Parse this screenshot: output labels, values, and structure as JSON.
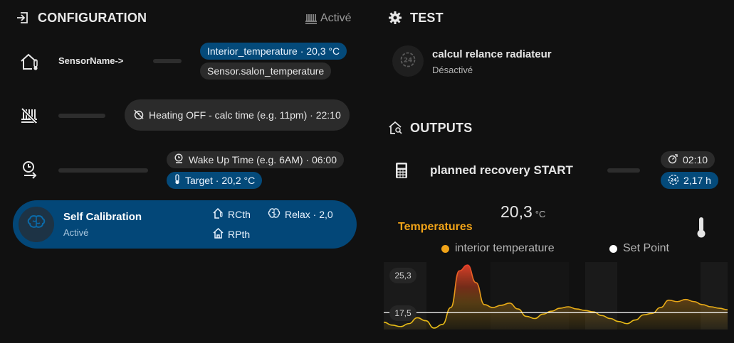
{
  "configuration": {
    "title": "CONFIGURATION",
    "status": "Activé",
    "sensor_label": "SensorName->",
    "interior_pill": "Interior_temperature · 20,3 °C",
    "sensor_pill": "Sensor.salon_temperature",
    "heating_pill": "Heating OFF - calc time (e.g. 11pm) · 22:10",
    "wakeup_pill": "Wake Up Time (e.g. 6AM) · 06:00",
    "target_pill": "Target · 20,2 °C",
    "self_cal": {
      "title": "Self Calibration",
      "status": "Activé",
      "rcth": "RCth",
      "rpth": "RPth",
      "relax": "Relax · 2,0"
    }
  },
  "test": {
    "title": "TEST",
    "item_title": "calcul relance radiateur",
    "item_status": "Désactivé"
  },
  "outputs": {
    "title": "OUTPUTS",
    "planned_label": "planned recovery START",
    "time_pill": "02:10",
    "hours_pill": "2,17 h"
  },
  "temperatures": {
    "title": "Temperatures",
    "value": "20,3",
    "unit": "°C",
    "legend_interior": "interior temperature",
    "legend_setpoint": "Set Point",
    "y_top": "25,3",
    "y_bottom": "17,5"
  },
  "chart_data": {
    "type": "area",
    "series": [
      {
        "name": "interior temperature",
        "color": "#e8a317",
        "values": [
          17.8,
          17.4,
          17.2,
          17.6,
          18.4,
          18.0,
          17.0,
          17.5,
          19.8,
          24.8,
          25.6,
          23.2,
          20.2,
          19.8,
          20.1,
          20.4,
          19.6,
          18.6,
          18.3,
          18.9,
          19.3,
          19.7,
          19.9,
          19.6,
          19.4,
          19.2,
          18.7,
          18.3,
          17.9,
          17.6,
          18.1,
          18.8,
          19.0,
          19.8,
          20.8,
          20.6,
          20.9,
          20.6,
          20.2,
          19.9,
          19.7,
          19.5
        ]
      },
      {
        "name": "Set Point",
        "color": "#ffffff",
        "values": [
          19.1,
          19.1,
          19.1,
          19.1,
          19.1,
          19.1,
          19.1,
          19.1,
          19.1,
          19.1,
          19.1,
          19.1,
          19.1,
          19.1,
          19.1,
          19.1,
          19.1,
          19.1,
          19.1,
          19.1,
          19.1,
          19.1,
          19.1,
          19.1,
          19.1,
          19.1,
          19.1,
          19.1,
          19.1,
          19.1,
          19.1,
          19.1,
          19.1,
          19.1,
          19.1,
          19.1,
          19.1,
          19.1,
          19.1,
          19.1,
          19.1,
          19.1
        ]
      }
    ],
    "ylim": [
      16.8,
      26.0
    ],
    "grid": false,
    "legend": "top"
  }
}
